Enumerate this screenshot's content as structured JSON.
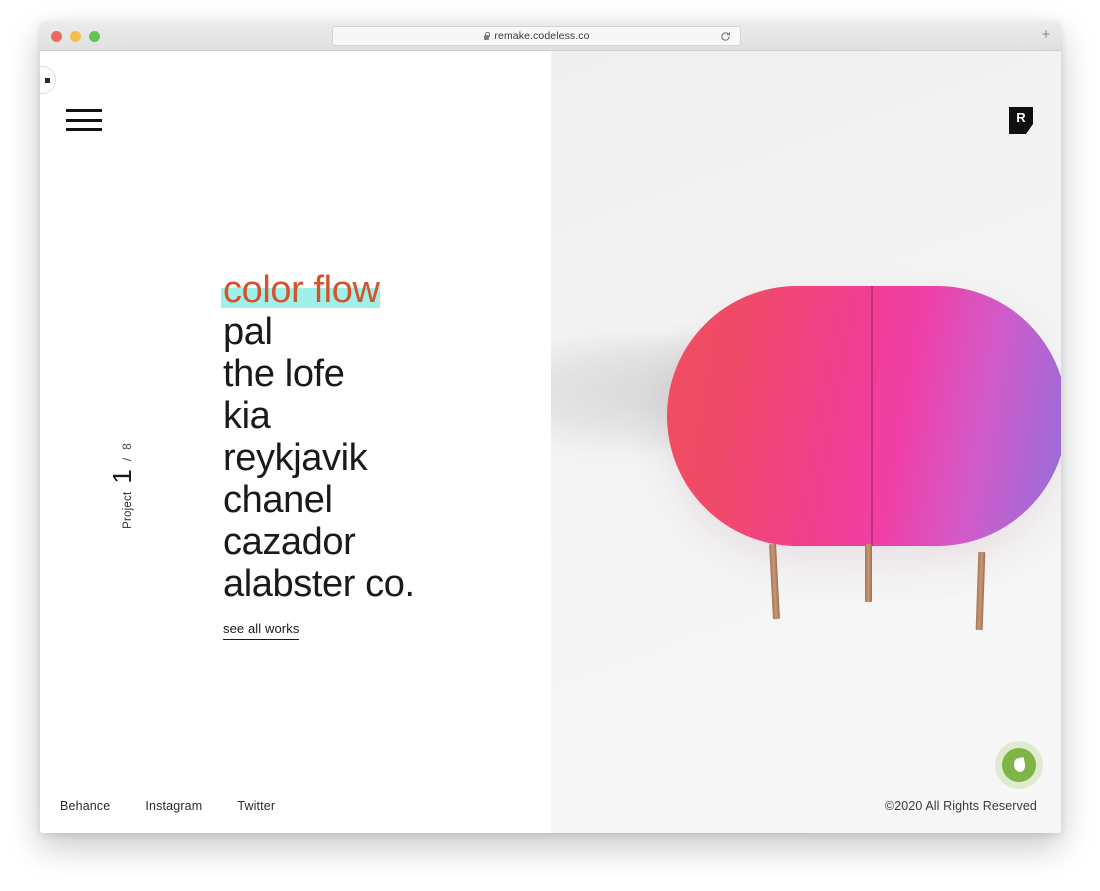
{
  "browser": {
    "url": "remake.codeless.co",
    "lock_icon": "lock-icon",
    "reload_icon": "reload-icon",
    "new_tab_label": "+",
    "traffic_lights": [
      "close",
      "minimize",
      "maximize"
    ]
  },
  "site": {
    "menu_icon": "hamburger-menu-icon",
    "logo_letter": "R",
    "project_counter": {
      "label": "Project",
      "current": "1",
      "separator": "/",
      "total": "8"
    },
    "headline": {
      "accent_color": "#d5532c",
      "highlight_color": "#9ff0e9",
      "items": [
        {
          "label": "color flow",
          "active": true
        },
        {
          "label": "pal",
          "active": false
        },
        {
          "label": "the lofe",
          "active": false
        },
        {
          "label": "kia",
          "active": false
        },
        {
          "label": "reykjavik",
          "active": false
        },
        {
          "label": "chanel",
          "active": false
        },
        {
          "label": "cazador",
          "active": false
        },
        {
          "label": "alabster co.",
          "active": false
        }
      ]
    },
    "cta": {
      "see_all_works": "see all works"
    },
    "footer": {
      "social": [
        {
          "label": "Behance"
        },
        {
          "label": "Instagram"
        },
        {
          "label": "Twitter"
        }
      ],
      "copyright": "©2020 All Rights Reserved"
    },
    "eco_widget": {
      "icon": "leaf-icon"
    },
    "hero_image": {
      "alt": "pink gradient pill-shaped cabinet with copper legs"
    }
  }
}
